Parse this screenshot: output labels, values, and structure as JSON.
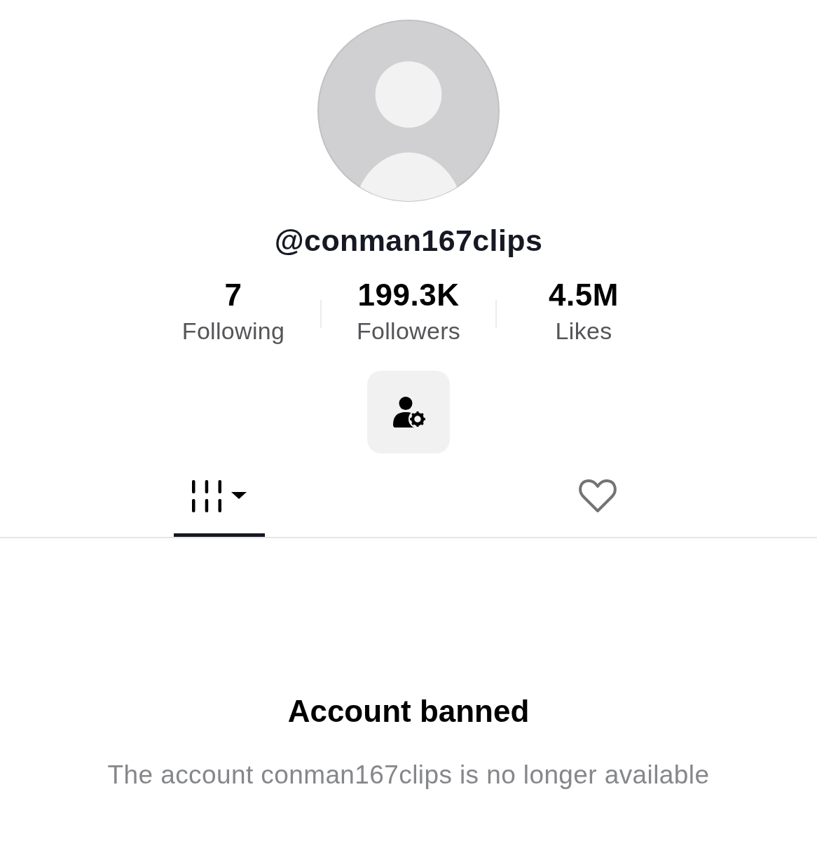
{
  "profile": {
    "username": "@conman167clips",
    "stats": [
      {
        "value": "7",
        "label": "Following"
      },
      {
        "value": "199.3K",
        "label": "Followers"
      },
      {
        "value": "4.5M",
        "label": "Likes"
      }
    ]
  },
  "tabs": [
    {
      "kind": "videos",
      "selected": true
    },
    {
      "kind": "liked",
      "selected": false
    }
  ],
  "empty_state": {
    "title": "Account banned",
    "message": "The account conman167clips is no longer available"
  }
}
